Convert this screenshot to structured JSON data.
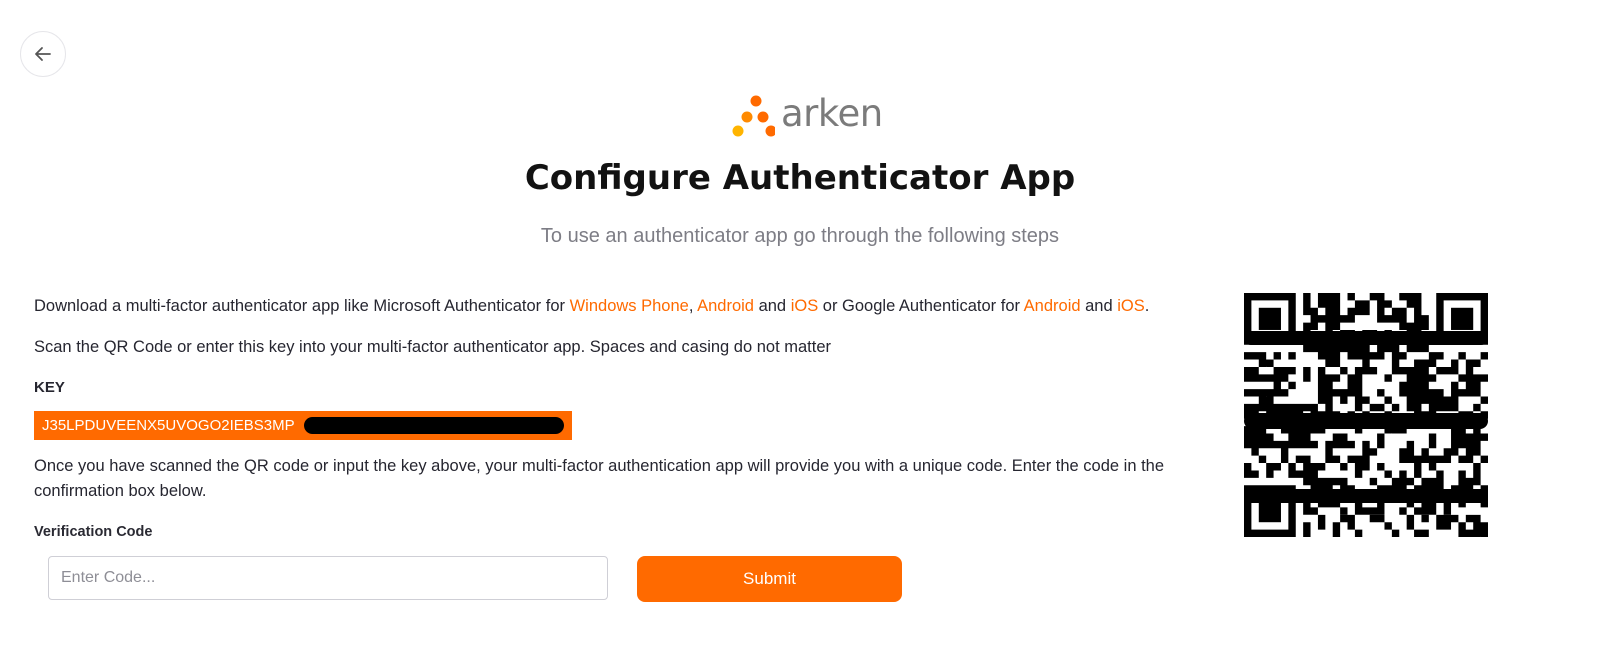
{
  "nav": {
    "back_icon": "arrow-left-icon"
  },
  "brand": {
    "name": "arken",
    "logo_colors": [
      "#ff6a00",
      "#ffb400",
      "#ff8a00"
    ]
  },
  "header": {
    "title": "Configure Authenticator App",
    "subtitle": "To use an authenticator app go through the following steps"
  },
  "steps": {
    "download": {
      "text_1": "Download a multi-factor authenticator app like Microsoft Authenticator for ",
      "link_windows_phone": "Windows Phone",
      "sep_comma": ", ",
      "link_android_1": "Android",
      "and_1": " and ",
      "link_ios_1": "iOS",
      "text_2": " or Google Authenticator for ",
      "link_android_2": "Android",
      "and_2": " and ",
      "link_ios_2": "iOS",
      "period": "."
    },
    "scan_text": "Scan the QR Code or enter this key into your multi-factor authenticator app. Spaces and casing do not matter",
    "key_label": "KEY",
    "key_value": "J35LPDUVEENX5UVOGO2IEBS3MP",
    "confirm_text": "Once you have scanned the QR code or input the key above, your multi-factor authentication app will provide you with a unique code. Enter the code in the confirmation box below."
  },
  "form": {
    "verification_label": "Verification Code",
    "code_placeholder": "Enter Code...",
    "code_value": "",
    "submit_label": "Submit"
  },
  "colors": {
    "accent": "#ff6a00",
    "text": "#262630",
    "muted": "#7d7d85"
  }
}
